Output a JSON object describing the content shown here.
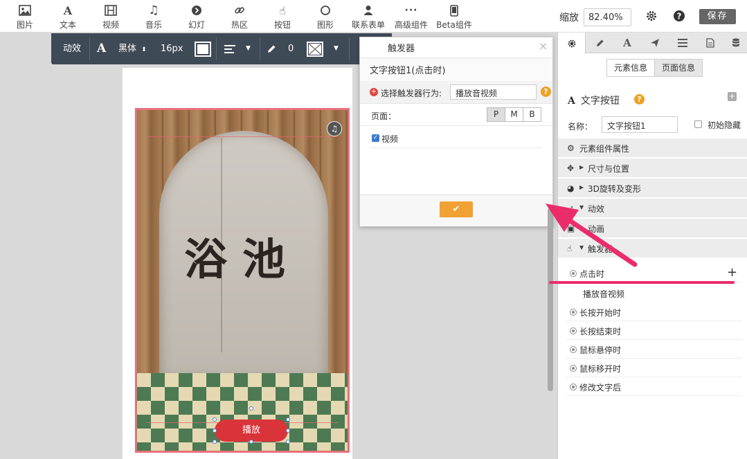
{
  "toolbar": {
    "items": [
      {
        "label": "图片",
        "icon": "image-icon"
      },
      {
        "label": "文本",
        "icon": "text-icon"
      },
      {
        "label": "视频",
        "icon": "video-icon"
      },
      {
        "label": "音乐",
        "icon": "music-icon"
      },
      {
        "label": "幻灯",
        "icon": "slideshow-icon"
      },
      {
        "label": "热区",
        "icon": "link-icon"
      },
      {
        "label": "按钮",
        "icon": "hand-pointer-icon"
      },
      {
        "label": "图形",
        "icon": "circle-icon"
      },
      {
        "label": "联系表单",
        "icon": "user-icon"
      },
      {
        "label": "高级组件",
        "icon": "more-icon"
      },
      {
        "label": "Beta组件",
        "icon": "phone-icon"
      }
    ],
    "zoom_label": "缩放",
    "zoom_value": "82.40%",
    "save_label": "保存"
  },
  "format_bar": {
    "animation_label": "动效",
    "font_name": "黑体",
    "font_size": "16px",
    "stroke_width": "0",
    "text_color": "#ffffff"
  },
  "canvas": {
    "title_text": "浴池",
    "button_label": "播放",
    "button_color": "#d9343a"
  },
  "dialog": {
    "title": "触发器",
    "subtitle": "文字按钮1(点击时)",
    "action_label": "选择触发器行为:",
    "action_value": "播放音视频",
    "page_label": "页面：",
    "page_options": [
      "P",
      "M",
      "B"
    ],
    "page_selected": "P",
    "video_checkbox_label": "视频",
    "video_checked": true
  },
  "panel": {
    "tabs": [
      "gear-icon",
      "pencil-icon",
      "text-icon",
      "send-icon",
      "list-icon",
      "document-icon",
      "database-icon"
    ],
    "segments": [
      "元素信息",
      "页面信息"
    ],
    "component_title": "文字按钮",
    "name_label": "名称：",
    "name_value": "文字按钮1",
    "initial_hide_label": "初始隐藏",
    "accordions": [
      {
        "label": "元素组件属性",
        "icon": "gear-icon"
      },
      {
        "label": "尺寸与位置",
        "icon": "move-icon"
      },
      {
        "label": "3D旋转及变形",
        "icon": "globe-icon"
      },
      {
        "label": "动效",
        "icon": "rocket-icon"
      },
      {
        "label": "动画",
        "icon": "film-icon"
      },
      {
        "label": "触发器",
        "icon": "hand-pointer-icon"
      }
    ],
    "triggers": [
      {
        "label": "点击时",
        "action": "播放音视频"
      },
      {
        "label": "长按开始时"
      },
      {
        "label": "长按结束时"
      },
      {
        "label": "鼠标悬停时"
      },
      {
        "label": "鼠标移开时"
      },
      {
        "label": "修改文字后"
      }
    ]
  },
  "colors": {
    "accent_orange": "#f2a134",
    "annotation_pink": "#ea2c6b",
    "format_bar_bg": "#3f4a57"
  }
}
